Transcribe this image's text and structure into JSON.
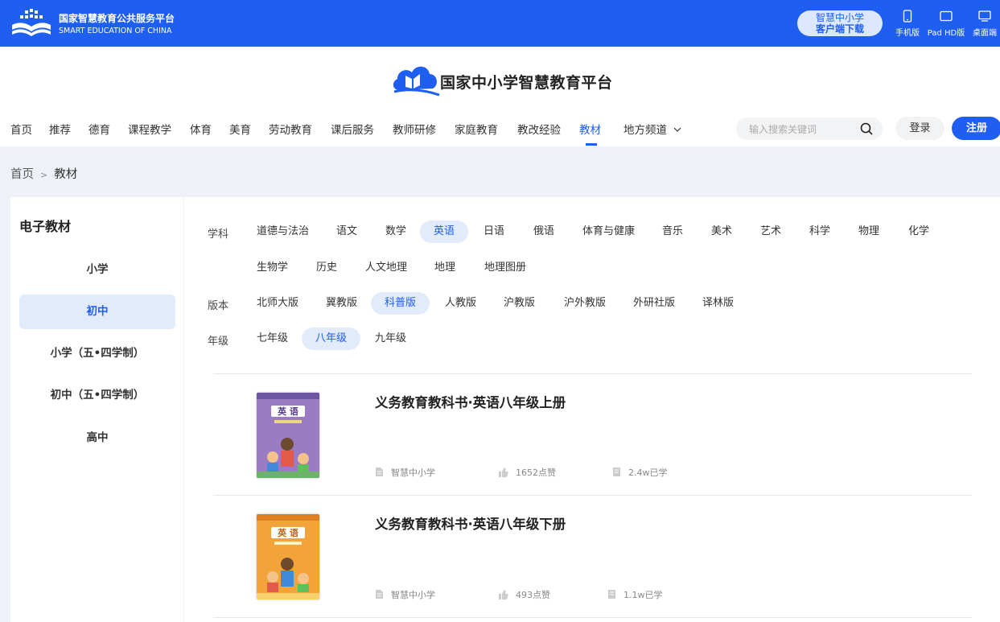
{
  "topbar": {
    "title": "国家智慧教育公共服务平台",
    "subtitle": "SMART EDUCATION OF CHINA",
    "client_line1": "智慧中小学",
    "client_line2": "客户端下载",
    "devices": [
      {
        "label": "手机版",
        "icon": "phone-icon"
      },
      {
        "label": "Pad HD版",
        "icon": "tablet-icon"
      },
      {
        "label": "桌面端",
        "icon": "desktop-icon"
      }
    ]
  },
  "header": {
    "title": "国家中小学智慧教育平台",
    "nav": [
      "首页",
      "推荐",
      "德育",
      "课程教学",
      "体育",
      "美育",
      "劳动教育",
      "课后服务",
      "教师研修",
      "家庭教育",
      "教改经验",
      "教材",
      "地方频道"
    ],
    "active_nav": "教材",
    "search_placeholder": "输入搜索关键词",
    "login": "登录",
    "register": "注册"
  },
  "breadcrumb": {
    "home": "首页",
    "sep": ">",
    "current": "教材"
  },
  "sidebar": {
    "title": "电子教材",
    "items": [
      "小学",
      "初中",
      "小学（五•四学制）",
      "初中（五•四学制）",
      "高中"
    ],
    "active": "初中"
  },
  "filters": {
    "subject_label": "学科",
    "subjects_row1": [
      "道德与法治",
      "语文",
      "数学",
      "英语",
      "日语",
      "俄语",
      "体育与健康",
      "音乐",
      "美术",
      "艺术",
      "科学",
      "物理",
      "化学"
    ],
    "subjects_row2": [
      "生物学",
      "历史",
      "人文地理",
      "地理",
      "地理图册"
    ],
    "active_subject": "英语",
    "edition_label": "版本",
    "editions": [
      "北师大版",
      "冀教版",
      "科普版",
      "人教版",
      "沪教版",
      "沪外教版",
      "外研社版",
      "译林版"
    ],
    "active_edition": "科普版",
    "grade_label": "年级",
    "grades": [
      "七年级",
      "八年级",
      "九年级"
    ],
    "active_grade": "八年级"
  },
  "books": [
    {
      "title": "义务教育教科书·英语八年级上册",
      "publisher": "智慧中小学",
      "likes": "1652点赞",
      "learned": "2.4w已学",
      "cover_text": "英 语",
      "cover_color": "#9b7cc2"
    },
    {
      "title": "义务教育教科书·英语八年级下册",
      "publisher": "智慧中小学",
      "likes": "493点赞",
      "learned": "1.1w已学",
      "cover_text": "英 语",
      "cover_color": "#f2a33a"
    }
  ]
}
